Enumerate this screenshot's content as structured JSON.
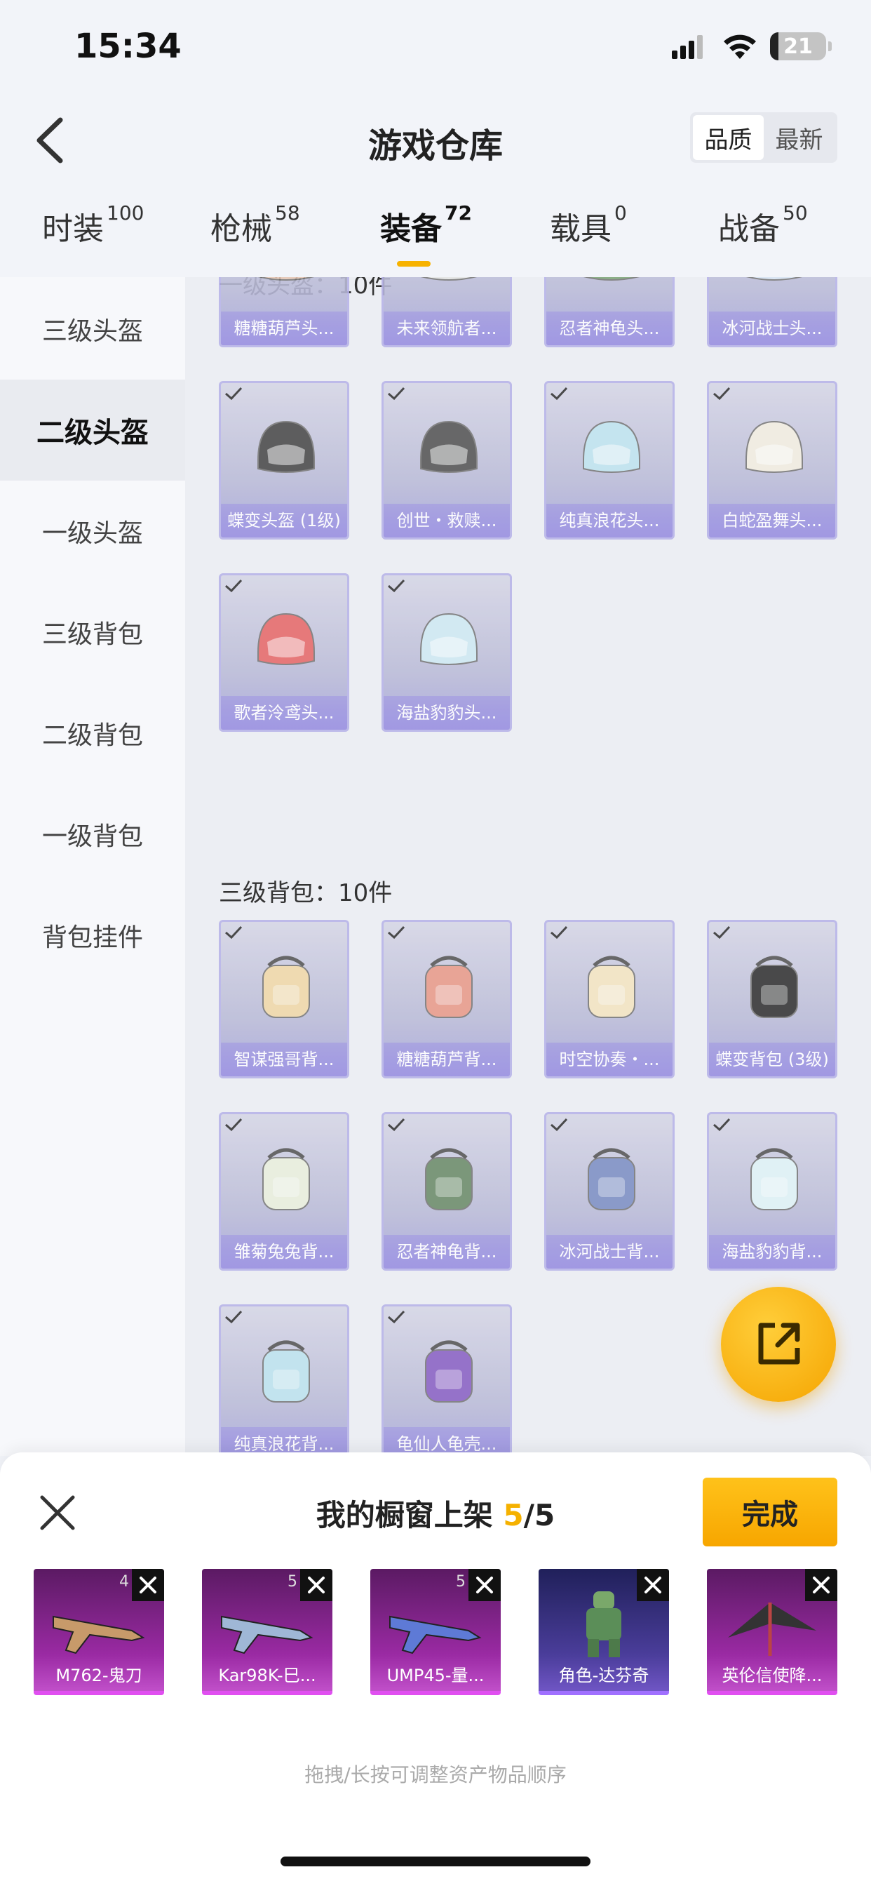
{
  "status": {
    "time": "15:34",
    "battery": "21"
  },
  "header": {
    "title": "游戏仓库",
    "sort_quality": "品质",
    "sort_newest": "最新"
  },
  "tabs": [
    {
      "label": "时装",
      "count": "100"
    },
    {
      "label": "枪械",
      "count": "58"
    },
    {
      "label": "装备",
      "count": "72"
    },
    {
      "label": "载具",
      "count": "0"
    },
    {
      "label": "战备",
      "count": "50"
    }
  ],
  "sidebar": [
    {
      "label": "三级头盔"
    },
    {
      "label": "二级头盔"
    },
    {
      "label": "一级头盔"
    },
    {
      "label": "三级背包"
    },
    {
      "label": "二级背包"
    },
    {
      "label": "一级背包"
    },
    {
      "label": "背包挂件"
    }
  ],
  "sections": {
    "helmet_header": "一级头盔：10件",
    "backpack_header": "三级背包：10件"
  },
  "helmets": [
    {
      "name": "糖糖葫芦头...",
      "color": "#e7c8b6"
    },
    {
      "name": "未来领航者...",
      "color": "#e5e5e5"
    },
    {
      "name": "忍者神龟头...",
      "color": "#7fa77a"
    },
    {
      "name": "冰河战士头...",
      "color": "#d8e4f4"
    },
    {
      "name": "蝶变头盔 (1级)",
      "color": "#4a4a4a"
    },
    {
      "name": "创世・救赎...",
      "color": "#555555"
    },
    {
      "name": "纯真浪花头...",
      "color": "#bfe3ef"
    },
    {
      "name": "白蛇盈舞头...",
      "color": "#f1ece0"
    },
    {
      "name": "歌者泠鸢头...",
      "color": "#e66a6a"
    },
    {
      "name": "海盐豹豹头...",
      "color": "#cfe9f2"
    }
  ],
  "backpacks": [
    {
      "name": "智谋强哥背...",
      "color": "#f0d8a8"
    },
    {
      "name": "糖糖葫芦背...",
      "color": "#e89a8a"
    },
    {
      "name": "时空协奏・...",
      "color": "#f3e4c2"
    },
    {
      "name": "蝶变背包 (3级)",
      "color": "#333333"
    },
    {
      "name": "雏菊兔兔背...",
      "color": "#e9eedd"
    },
    {
      "name": "忍者神龟背...",
      "color": "#6c8c6a"
    },
    {
      "name": "冰河战士背...",
      "color": "#7d8fc4"
    },
    {
      "name": "海盐豹豹背...",
      "color": "#dff2f6"
    },
    {
      "name": "纯真浪花背...",
      "color": "#bde2ee"
    },
    {
      "name": "龟仙人龟壳...",
      "color": "#8a62c4"
    }
  ],
  "shelf": {
    "title": "我的橱窗上架",
    "count": "5",
    "total": "/5",
    "done": "完成",
    "hint": "拖拽/长按可调整资产物品顺序",
    "items": [
      {
        "name": "M762-鬼刀",
        "num": "4"
      },
      {
        "name": "Kar98K-巳...",
        "num": "5"
      },
      {
        "name": "UMP45-量...",
        "num": "5"
      },
      {
        "name": "角色-达芬奇",
        "num": ""
      },
      {
        "name": "英伦信使降...",
        "num": ""
      }
    ]
  }
}
